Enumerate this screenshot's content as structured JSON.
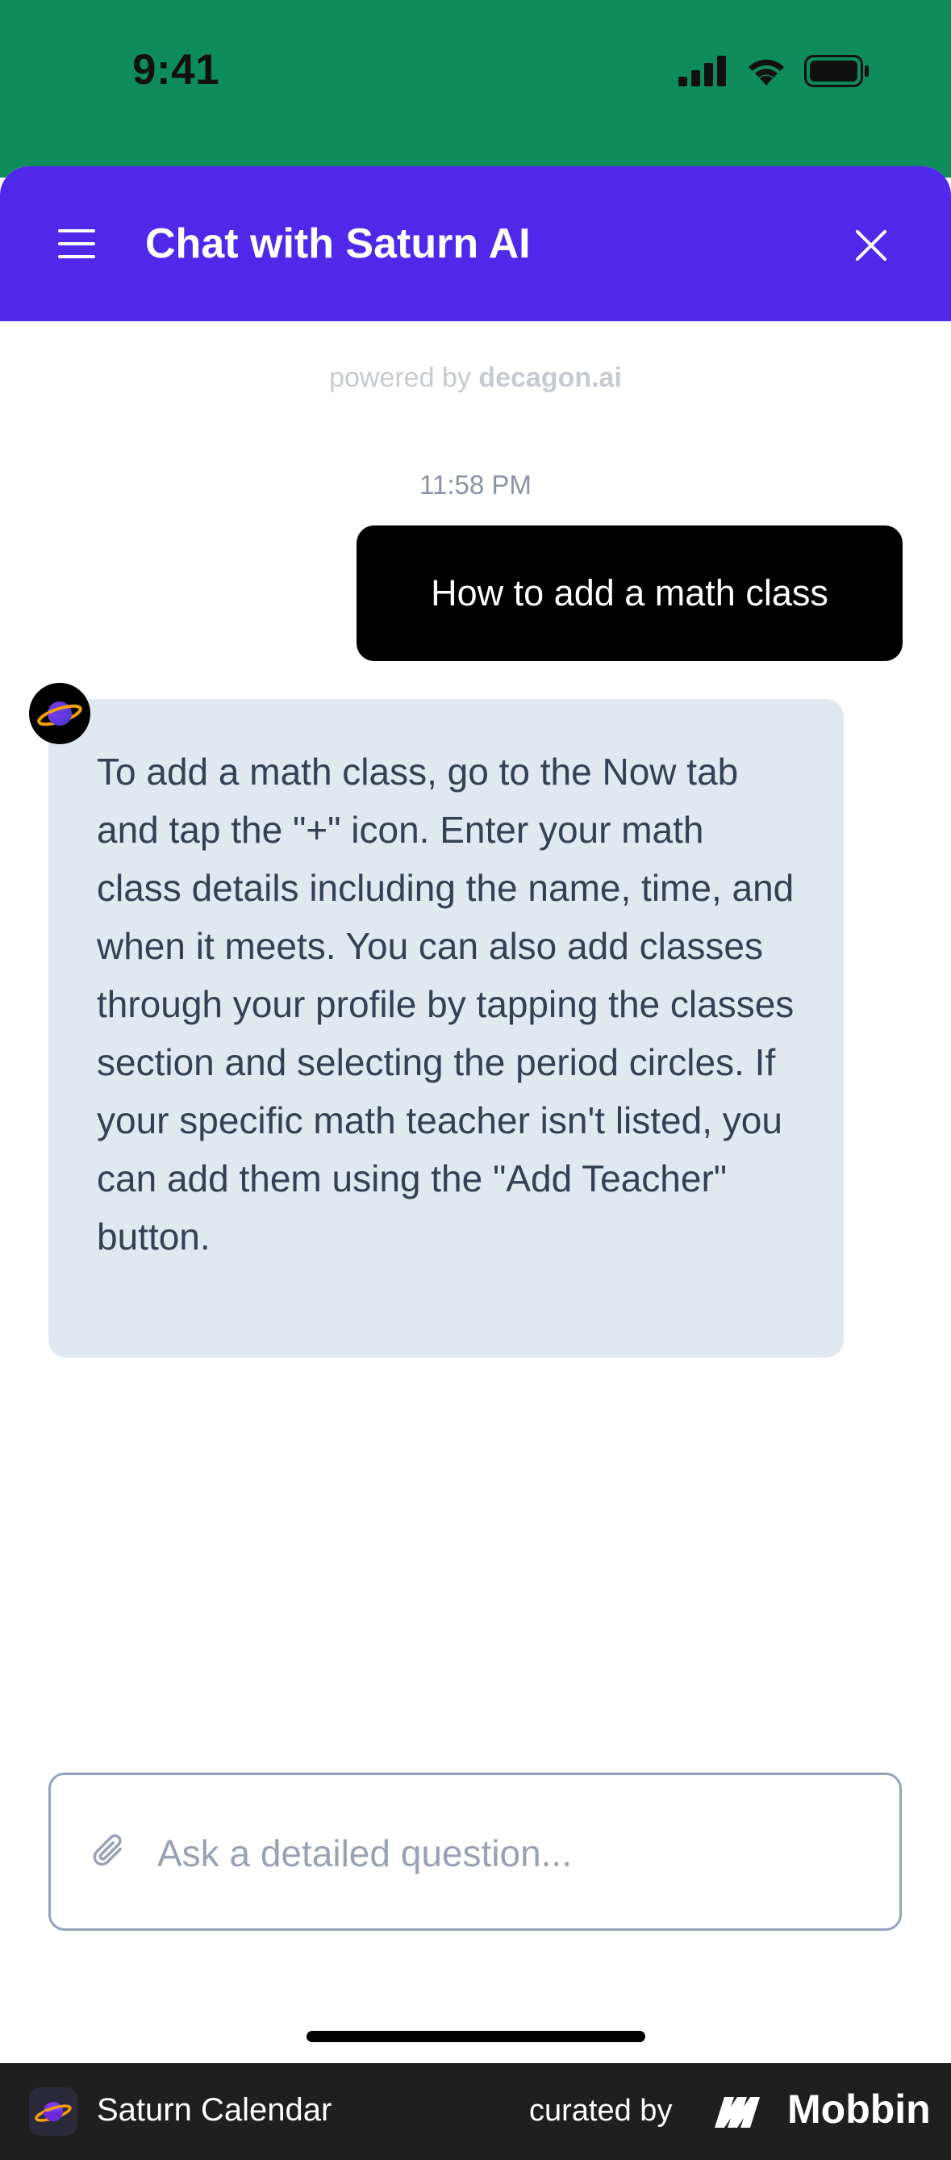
{
  "status_bar": {
    "time": "9:41",
    "background": "#0f8c5c"
  },
  "header": {
    "title": "Chat with Saturn AI",
    "menu_icon": "menu-icon",
    "close_icon": "close-icon",
    "background": "#4f28ea"
  },
  "branding": {
    "prefix": "powered by ",
    "brand": "decagon.ai"
  },
  "chat": {
    "timestamp": "11:58 PM",
    "messages": [
      {
        "role": "user",
        "text": "How to add a math class"
      },
      {
        "role": "assistant",
        "avatar_icon": "saturn-planet-icon",
        "text": "To add a math class, go to the Now tab and tap the \"+\" icon. Enter your math class details including the name, time, and when it meets. You can also add classes through your profile by tapping the classes section and selecting the period circles. If your specific math teacher isn't listed, you can add them using the \"Add Teacher\" button."
      }
    ]
  },
  "composer": {
    "placeholder": "Ask a detailed question...",
    "value": "",
    "attach_icon": "paperclip-icon"
  },
  "footer": {
    "app_name": "Saturn Calendar",
    "curated_by": "curated by",
    "brand": "Mobbin"
  }
}
